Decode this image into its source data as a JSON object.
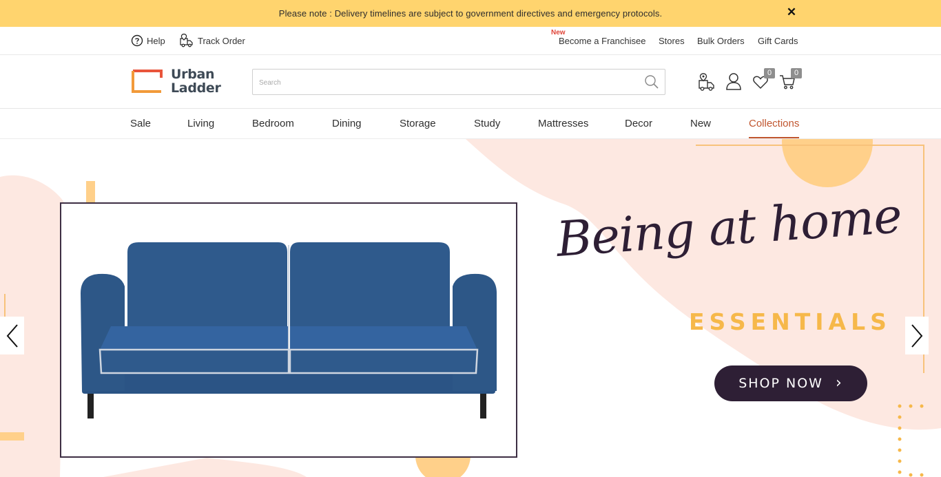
{
  "notice": {
    "text": "Please note : Delivery timelines are subject to government directives and emergency protocols.",
    "close_symbol": "✕"
  },
  "utility": {
    "help_label": "Help",
    "track_label": "Track Order",
    "new_tag": "New",
    "links": [
      "Become a Franchisee",
      "Stores",
      "Bulk Orders",
      "Gift Cards"
    ]
  },
  "header": {
    "logo_line1": "Urban",
    "logo_line2": "Ladder",
    "search_placeholder": "Search",
    "wishlist_count": "0",
    "cart_count": "0"
  },
  "nav": {
    "items": [
      "Sale",
      "Living",
      "Bedroom",
      "Dining",
      "Storage",
      "Study",
      "Mattresses",
      "Decor",
      "New",
      "Collections"
    ],
    "active": "Collections"
  },
  "hero": {
    "title": "Being at home",
    "subtitle": "ESSENTIALS",
    "cta_label": "SHOP NOW",
    "cta_arrow": "›"
  },
  "colors": {
    "accent": "#c0552e",
    "notice_bg": "#ffd46e",
    "hero_dark": "#2e1f35",
    "hero_gold": "#f6b84a",
    "hero_blush": "#fce7e1",
    "sofa_blue": "#2f5a8c"
  }
}
